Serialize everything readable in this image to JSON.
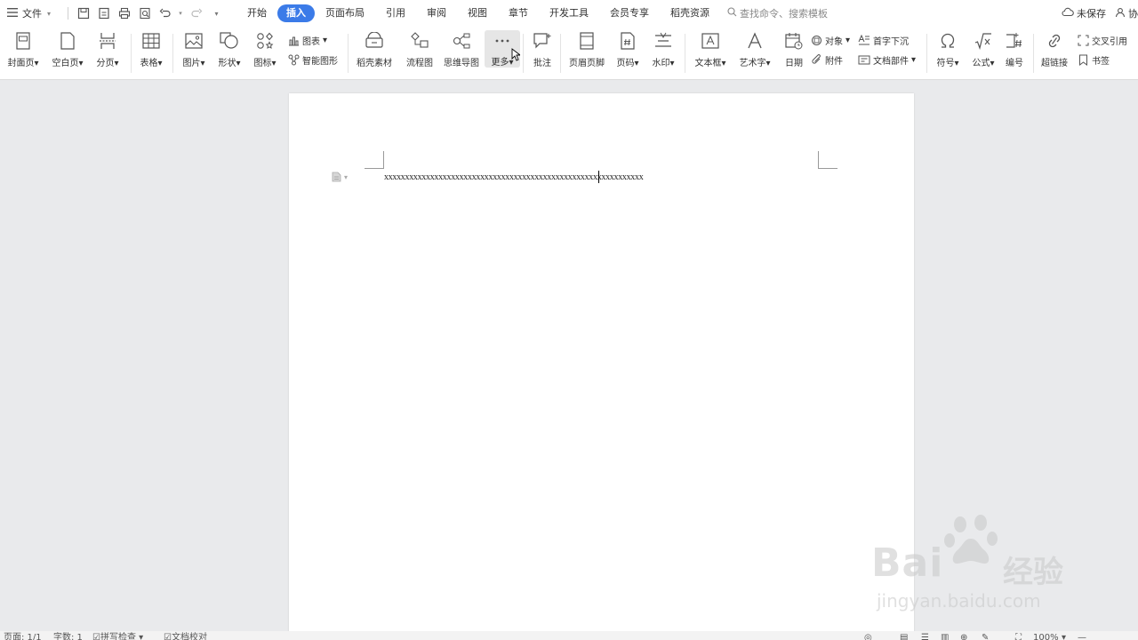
{
  "menubar": {
    "file_label": "文件",
    "tabs": [
      {
        "label": "开始"
      },
      {
        "label": "插入",
        "active": true
      },
      {
        "label": "页面布局"
      },
      {
        "label": "引用"
      },
      {
        "label": "审阅"
      },
      {
        "label": "视图"
      },
      {
        "label": "章节"
      },
      {
        "label": "开发工具"
      },
      {
        "label": "会员专享"
      },
      {
        "label": "稻壳资源"
      }
    ],
    "search_placeholder": "查找命令、搜索模板",
    "unsaved_label": "未保存",
    "collab_label": "协"
  },
  "ribbon": {
    "cover_page": "封面页",
    "blank_page": "空白页",
    "page_break": "分页",
    "table": "表格",
    "picture": "图片",
    "shape": "形状",
    "icon": "图标",
    "chart": "图表",
    "smart_art": "智能图形",
    "docer_material": "稻壳素材",
    "flowchart": "流程图",
    "mindmap": "思维导图",
    "more": "更多",
    "comment": "批注",
    "header_footer": "页眉页脚",
    "page_number": "页码",
    "watermark": "水印",
    "textbox": "文本框",
    "wordart": "艺术字",
    "date": "日期",
    "object": "对象",
    "attachment": "附件",
    "drop_cap": "首字下沉",
    "doc_parts": "文档部件",
    "symbol": "符号",
    "formula": "公式",
    "numbering": "编号",
    "hyperlink": "超链接",
    "cross_ref": "交叉引用",
    "bookmark": "书签"
  },
  "document": {
    "text": "xxxxxxxxxxxxxxxxxxxxxxxxxxxxxxxxxxxxxxxxxxxxxxxxxxxxxxxxxxxxxx"
  },
  "statusbar": {
    "page": "页面: 1/1",
    "words": "字数: 1",
    "spell_check": "拼写检查",
    "doc_proof": "文档校对",
    "zoom": "100%"
  },
  "watermark": {
    "brand": "Bai",
    "brand_cn": "经验",
    "url": "jingyan.baidu.com"
  },
  "colors": {
    "accent": "#3b7be8",
    "ribbon_bg": "#ffffff",
    "canvas_bg": "#e9eaec"
  }
}
